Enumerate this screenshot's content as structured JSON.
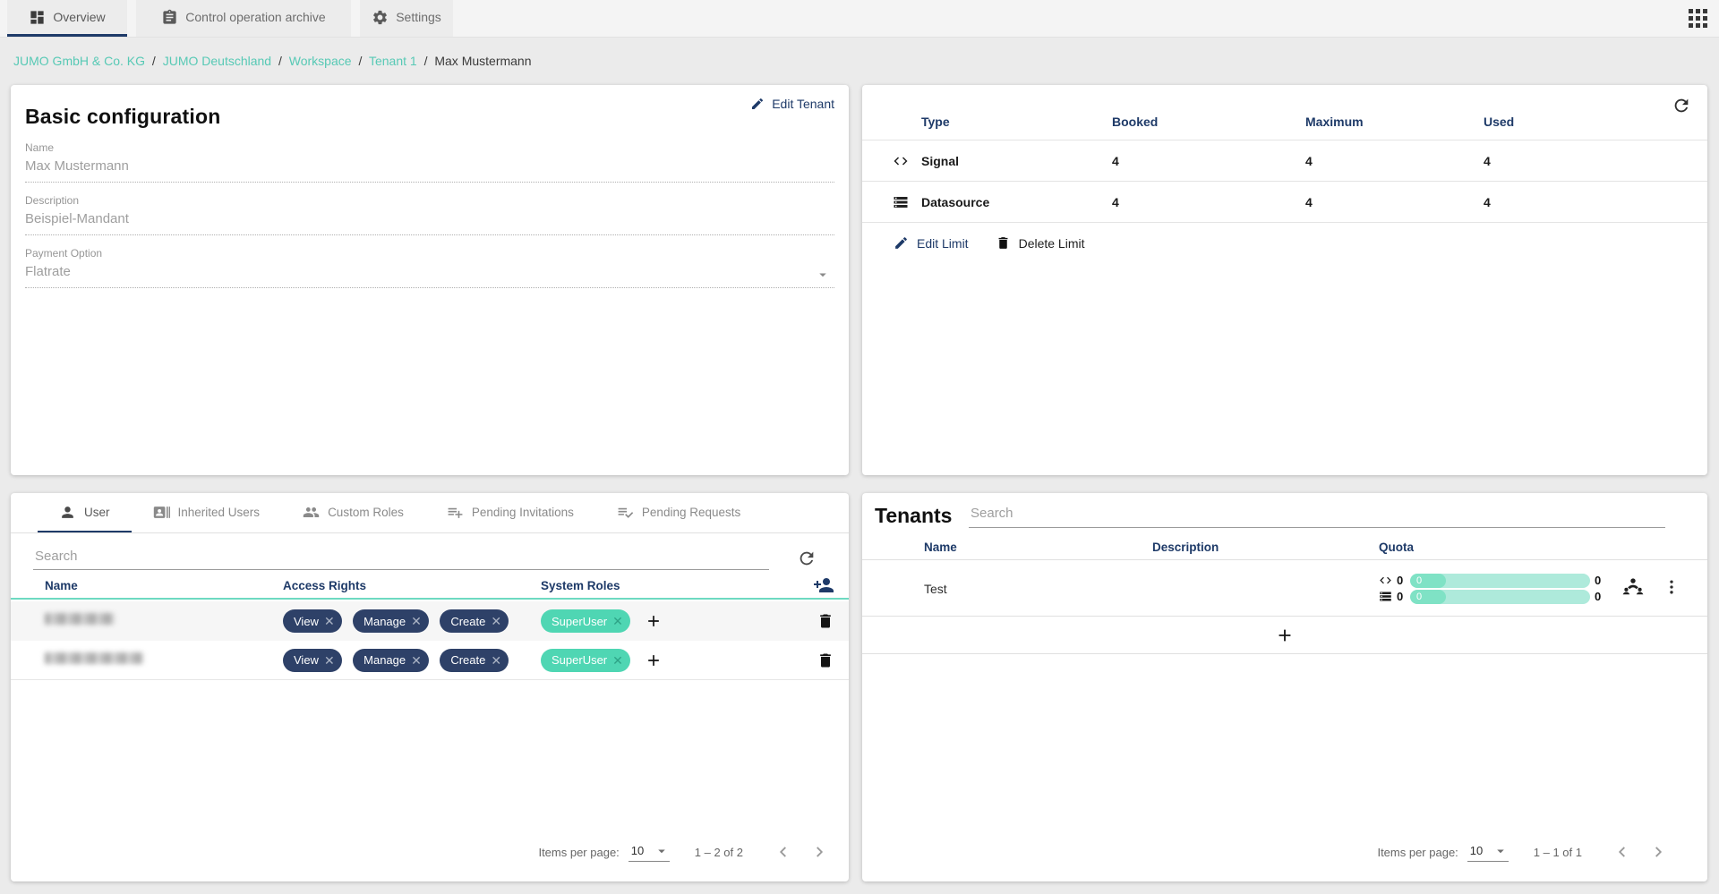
{
  "colors": {
    "navy": "#1e3a68",
    "chip-navy": "#2e4168",
    "teal": "#4fd6b3",
    "teal-light": "#aeeadb",
    "teal-fill": "#7fe2c5",
    "teal-link": "#57c9b5",
    "teal-line": "#6edac1",
    "page-bg": "#ebebeb"
  },
  "app": {
    "tabs": [
      {
        "label": "Overview",
        "icon": "dashboard-icon",
        "active": true
      },
      {
        "label": "Control operation archive",
        "icon": "clipboard-icon",
        "active": false
      },
      {
        "label": "Settings",
        "icon": "gear-icon",
        "active": false
      }
    ],
    "apps_icon": "apps-grid-icon"
  },
  "breadcrumb": {
    "separator": "/",
    "links": [
      "JUMO GmbH & Co. KG",
      "JUMO Deutschland",
      "Workspace",
      "Tenant 1"
    ],
    "current": "Max Mustermann"
  },
  "basic_config": {
    "title": "Basic configuration",
    "edit_button": "Edit Tenant",
    "fields": [
      {
        "label": "Name",
        "value": "Max Mustermann"
      },
      {
        "label": "Description",
        "value": "Beispiel-Mandant"
      },
      {
        "label": "Payment Option",
        "value": "Flatrate",
        "dropdown": true
      }
    ]
  },
  "limits": {
    "refresh_icon": "refresh-icon",
    "columns": [
      "Type",
      "Booked",
      "Maximum",
      "Used"
    ],
    "rows": [
      {
        "icon": "code-icon",
        "type": "Signal",
        "booked": "4",
        "maximum": "4",
        "used": "4"
      },
      {
        "icon": "storage-icon",
        "type": "Datasource",
        "booked": "4",
        "maximum": "4",
        "used": "4"
      }
    ],
    "edit_button": "Edit Limit",
    "delete_button": "Delete Limit"
  },
  "users": {
    "tabs": [
      {
        "label": "User",
        "icon": "person-icon",
        "active": true
      },
      {
        "label": "Inherited Users",
        "icon": "contact-badge-icon",
        "active": false
      },
      {
        "label": "Custom Roles",
        "icon": "people-icon",
        "active": false
      },
      {
        "label": "Pending Invitations",
        "icon": "list-add-icon",
        "active": false
      },
      {
        "label": "Pending Requests",
        "icon": "list-check-icon",
        "active": false
      }
    ],
    "search_placeholder": "Search",
    "search_value": "",
    "columns": [
      "Name",
      "Access Rights",
      "System Roles"
    ],
    "add_user_icon": "person-add-icon",
    "rows": [
      {
        "name": "",
        "name_redacted": true,
        "access_rights": [
          "View",
          "Manage",
          "Create"
        ],
        "system_roles": [
          "SuperUser"
        ]
      },
      {
        "name": "",
        "name_redacted": true,
        "access_rights": [
          "View",
          "Manage",
          "Create"
        ],
        "system_roles": [
          "SuperUser"
        ]
      }
    ],
    "pagination": {
      "label": "Items per page:",
      "page_size": "10",
      "range": "1 – 2 of 2"
    }
  },
  "tenants": {
    "title": "Tenants",
    "search_placeholder": "Search",
    "search_value": "",
    "columns": [
      "Name",
      "Description",
      "Quota"
    ],
    "rows": [
      {
        "name": "Test",
        "description": "",
        "quota": [
          {
            "icon": "code-icon",
            "value": "0",
            "bar_value": "0",
            "max": "0"
          },
          {
            "icon": "storage-icon",
            "value": "0",
            "bar_value": "0",
            "max": "0"
          }
        ],
        "row_icons": [
          "user-group-icon",
          "kebab-menu-icon"
        ]
      }
    ],
    "pagination": {
      "label": "Items per page:",
      "page_size": "10",
      "range": "1 – 1 of 1"
    }
  }
}
